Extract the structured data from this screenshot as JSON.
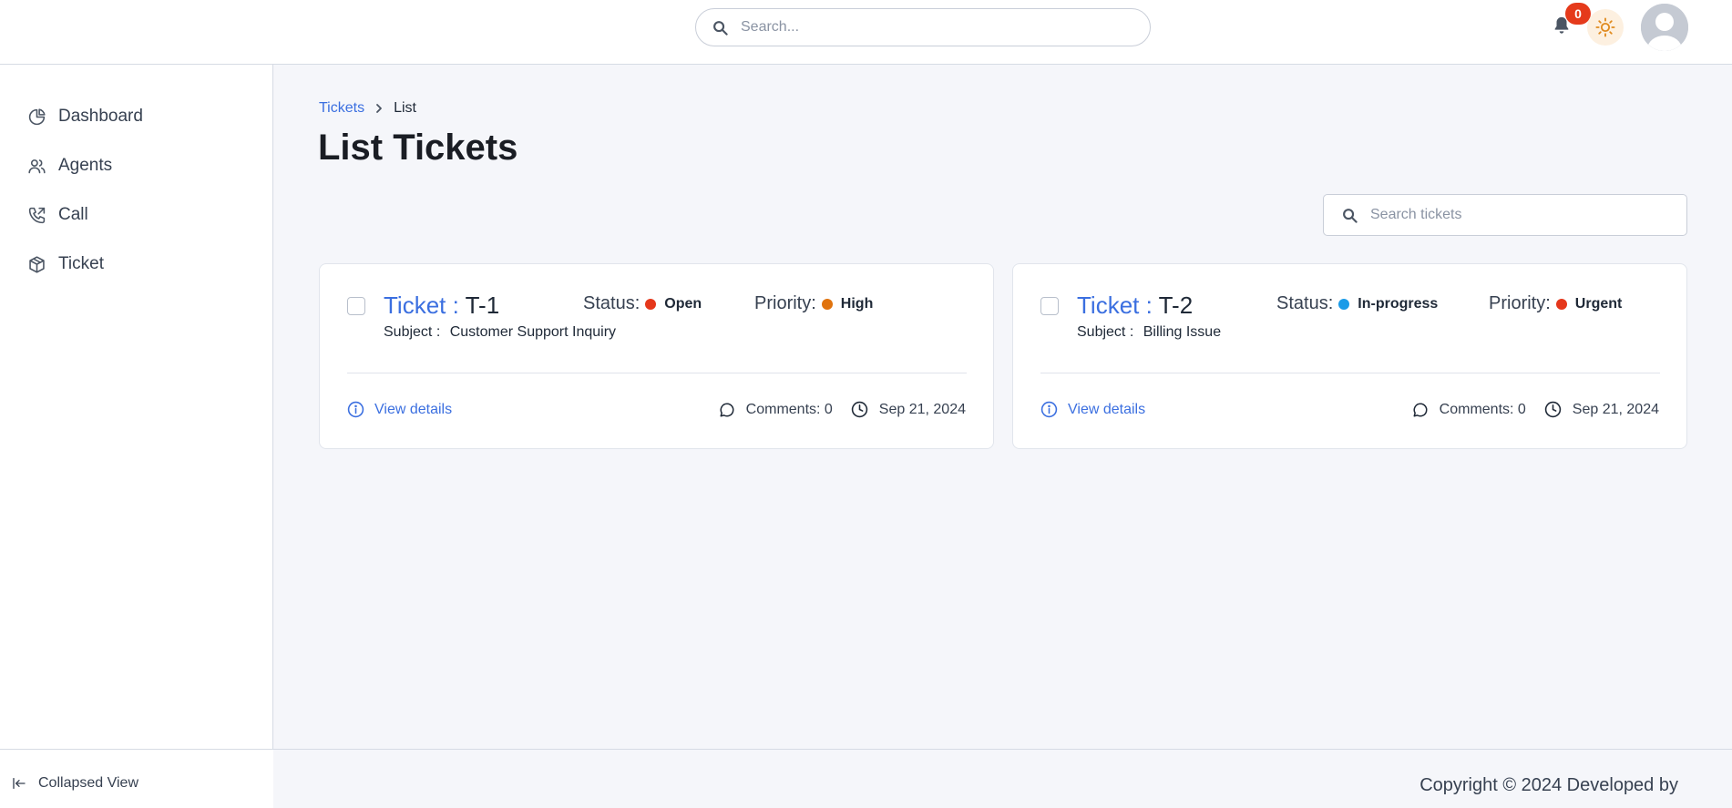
{
  "header": {
    "search_placeholder": "Search...",
    "notifications_count": "0",
    "icons": {
      "search": "search-icon",
      "bell": "bell-icon",
      "theme": "sun-icon",
      "avatar": "user-avatar"
    }
  },
  "sidebar": {
    "items": [
      {
        "label": "Dashboard",
        "icon": "pie-chart-icon"
      },
      {
        "label": "Agents",
        "icon": "users-icon"
      },
      {
        "label": "Call",
        "icon": "phone-outgoing-icon"
      },
      {
        "label": "Ticket",
        "icon": "box-icon"
      }
    ],
    "collapse_label": "Collapsed View"
  },
  "breadcrumb": {
    "parent": "Tickets",
    "current": "List"
  },
  "page": {
    "title": "List Tickets",
    "search_placeholder": "Search tickets"
  },
  "tickets": [
    {
      "prefix": "Ticket :",
      "id": "T-1",
      "subject_label": "Subject :",
      "subject": "Customer Support Inquiry",
      "status_label": "Status:",
      "status": "Open",
      "status_color": "#e5371b",
      "priority_label": "Priority:",
      "priority": "High",
      "priority_color": "#e0730e",
      "view_label": "View details",
      "comments": "Comments: 0",
      "date": "Sep 21, 2024"
    },
    {
      "prefix": "Ticket :",
      "id": "T-2",
      "subject_label": "Subject :",
      "subject": "Billing Issue",
      "status_label": "Status:",
      "status": "In-progress",
      "status_color": "#1a9be8",
      "priority_label": "Priority:",
      "priority": "Urgent",
      "priority_color": "#e5371b",
      "view_label": "View details",
      "comments": "Comments: 0",
      "date": "Sep 21, 2024"
    }
  ],
  "footer": {
    "copyright": "Copyright © 2024 Developed by"
  },
  "colors": {
    "accent": "#3b6fe0",
    "badge": "#e53a1b",
    "background": "#f5f6fa"
  }
}
